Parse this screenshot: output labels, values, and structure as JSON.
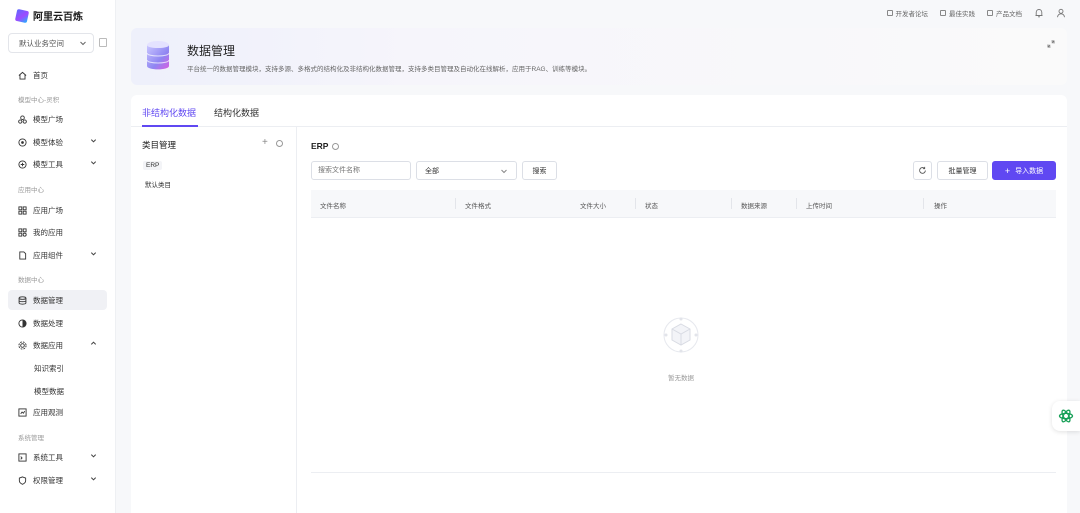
{
  "app": {
    "logo_text": "阿里云百炼"
  },
  "sidebar": {
    "workspace": "默认业务空间",
    "home": "首页",
    "group_model": "模型中心-灵积",
    "model_square": "模型广场",
    "model_experience": "模型体验",
    "model_tools": "模型工具",
    "group_app": "应用中心",
    "app_square": "应用广场",
    "my_apps": "我的应用",
    "app_components": "应用组件",
    "group_data": "数据中心",
    "data_management": "数据管理",
    "data_processing": "数据处理",
    "data_application": "数据应用",
    "knowledge_index": "知识索引",
    "model_data": "模型数据",
    "app_observation": "应用观测",
    "group_system": "系统管理",
    "system_tools": "系统工具",
    "permission_management": "权限管理"
  },
  "topbar": {
    "dev_forum": "开发者论坛",
    "best_practice": "最佳实践",
    "product_docs": "产品文档"
  },
  "header": {
    "title": "数据管理",
    "description": "平台统一的数据管理模块，支持多源、多格式的结构化及非结构化数据管理，支持多类目管理及自动化在线解析，应用于RAG、训练等模块。"
  },
  "tabs": [
    {
      "label": "非结构化数据",
      "active": true
    },
    {
      "label": "结构化数据",
      "active": false
    }
  ],
  "category": {
    "title": "类目管理",
    "tag": "ERP",
    "sub": "默认类目"
  },
  "content": {
    "title": "ERP",
    "search_placeholder": "搜索文件名称",
    "select_value": "全部",
    "search_button": "搜索",
    "batch_button": "批量管理",
    "import_button": "导入数据",
    "columns": [
      "文件名称",
      "文件格式",
      "文件大小",
      "状态",
      "数据来源",
      "上传时间",
      "操作"
    ],
    "empty_text": "暂无数据"
  },
  "colors": {
    "accent": "#6048f2"
  }
}
